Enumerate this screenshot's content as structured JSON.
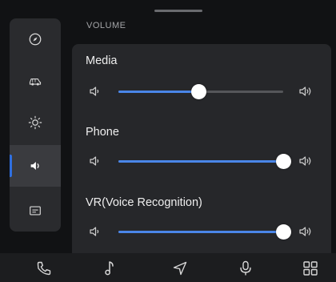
{
  "section_title": "VOLUME",
  "accent_color": "#4a86e8",
  "rail": {
    "items": [
      {
        "icon": "compass-icon",
        "active": false
      },
      {
        "icon": "car-icon",
        "active": false
      },
      {
        "icon": "brightness-icon",
        "active": false
      },
      {
        "icon": "volume-icon",
        "active": true
      },
      {
        "icon": "display-icon",
        "active": false
      }
    ]
  },
  "sliders": [
    {
      "label": "Media",
      "level": 0.49
    },
    {
      "label": "Phone",
      "level": 1.0
    },
    {
      "label": "VR(Voice Recognition)",
      "level": 1.0
    }
  ],
  "dock": {
    "items": [
      {
        "icon": "phone-icon"
      },
      {
        "icon": "music-note-icon"
      },
      {
        "icon": "navigation-icon"
      },
      {
        "icon": "microphone-icon"
      },
      {
        "icon": "apps-grid-icon"
      }
    ]
  }
}
